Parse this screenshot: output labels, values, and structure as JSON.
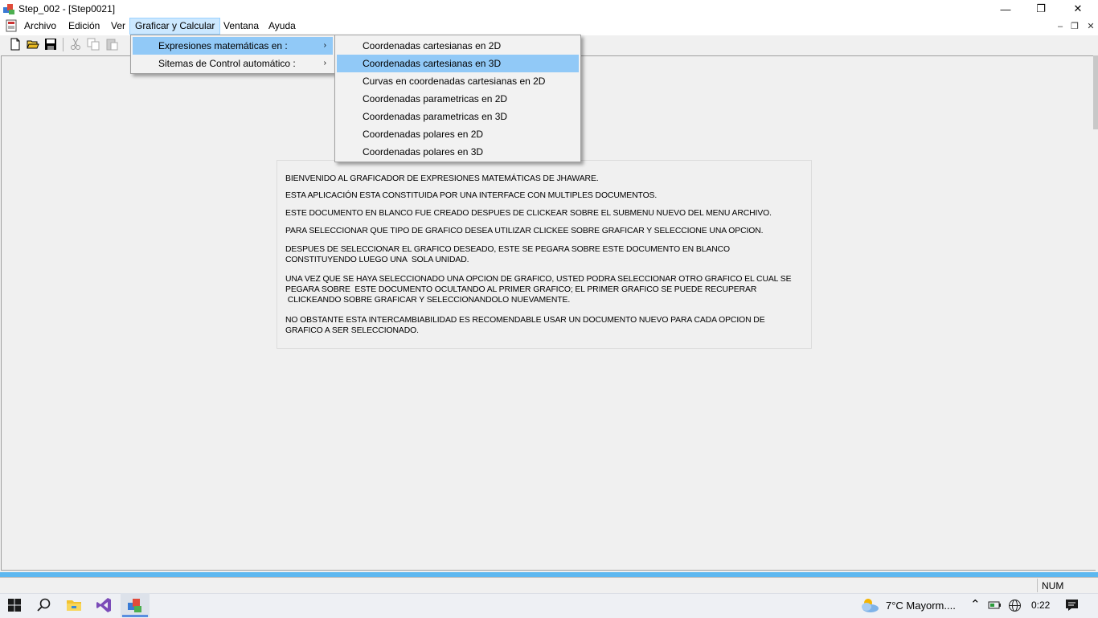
{
  "window": {
    "title": "Step_002 - [Step0021]",
    "min": "—",
    "max": "❐",
    "close": "✕"
  },
  "menubar": {
    "items": [
      "Archivo",
      "Edición",
      "Ver",
      "Graficar y Calcular",
      "Ventana",
      "Ayuda"
    ],
    "mdi": {
      "min": "–",
      "restore": "❐",
      "close": "✕"
    }
  },
  "graficar_menu": {
    "items": [
      {
        "label": "Expresiones matemáticas en :",
        "arrow": "›"
      },
      {
        "label": "Sitemas de Control automático :",
        "arrow": "›"
      }
    ]
  },
  "submenu": {
    "items": [
      "Coordenadas cartesianas en 2D",
      "Coordenadas cartesianas en 3D",
      "Curvas en coordenadas cartesianas en 2D",
      "Coordenadas parametricas en 2D",
      "Coordenadas parametricas en 3D",
      "Coordenadas polares en 2D",
      "Coordenadas polares en 3D"
    ]
  },
  "info": {
    "lines": [
      "BIENVENIDO AL GRAFICADOR DE EXPRESIONES MATEMÁTICAS DE JHAWARE.",
      "ESTA APLICACIÓN ESTA CONSTITUIDA POR UNA INTERFACE CON MULTIPLES DOCUMENTOS.",
      "ESTE DOCUMENTO EN BLANCO FUE CREADO DESPUES DE CLICKEAR SOBRE EL SUBMENU NUEVO DEL MENU ARCHIVO.",
      "PARA SELECCIONAR QUE TIPO DE GRAFICO DESEA UTILIZAR CLICKEE SOBRE GRAFICAR Y SELECCIONE UNA OPCION.",
      "DESPUES DE SELECCIONAR EL GRAFICO DESEADO, ESTE SE PEGARA SOBRE ESTE DOCUMENTO EN BLANCO",
      "CONSTITUYENDO LUEGO UNA  SOLA UNIDAD.",
      "UNA VEZ QUE SE HAYA SELECCIONADO UNA OPCION DE GRAFICO, USTED PODRA SELECCIONAR OTRO GRAFICO EL CUAL SE",
      "PEGARA SOBRE  ESTE DOCUMENTO OCULTANDO AL PRIMER GRAFICO; EL PRIMER GRAFICO SE PUEDE RECUPERAR",
      " CLICKEANDO SOBRE GRAFICAR Y SELECCIONANDOLO NUEVAMENTE.",
      "NO OBSTANTE ESTA INTERCAMBIABILIDAD ES RECOMENDABLE USAR UN DOCUMENTO NUEVO PARA CADA OPCION DE",
      "GRAFICO A SER SELECCIONADO."
    ]
  },
  "statusbar": {
    "num": "NUM"
  },
  "taskbar": {
    "weather": "7°C  Mayorm....",
    "clock": "0:22"
  }
}
